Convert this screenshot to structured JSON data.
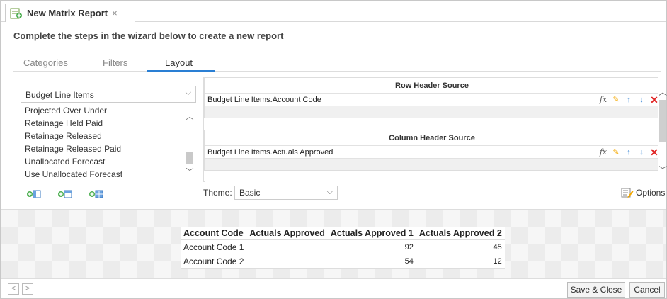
{
  "tab": {
    "title": "New Matrix Report",
    "close": "×"
  },
  "subtitle": "Complete the steps in the wizard below to create a new report",
  "wizard_tabs": [
    {
      "label": "Categories"
    },
    {
      "label": "Filters"
    },
    {
      "label": "Layout"
    }
  ],
  "left_panel": {
    "source_select": "Budget Line Items",
    "fields": [
      "Projected Over Under",
      "Retainage Held Paid",
      "Retainage Released",
      "Retainage Released Paid",
      "Unallocated Forecast",
      "Use Unallocated Forecast"
    ]
  },
  "row_header": {
    "title": "Row Header Source",
    "value": "Budget Line Items.Account Code"
  },
  "column_header": {
    "title": "Column Header Source",
    "value": "Budget Line Items.Actuals Approved"
  },
  "tools": {
    "fx": "fx"
  },
  "theme": {
    "label": "Theme:",
    "value": "Basic"
  },
  "options_label": "Options",
  "preview": {
    "headers": [
      "Account Code",
      "Actuals Approved",
      "Actuals Approved 1",
      "Actuals Approved 2"
    ],
    "rows": [
      {
        "label": "Account Code 1",
        "c1": "",
        "c2": "92",
        "c3": "45"
      },
      {
        "label": "Account Code 2",
        "c1": "",
        "c2": "54",
        "c3": "12"
      }
    ]
  },
  "footer": {
    "save_close": "Save & Close",
    "cancel": "Cancel"
  }
}
